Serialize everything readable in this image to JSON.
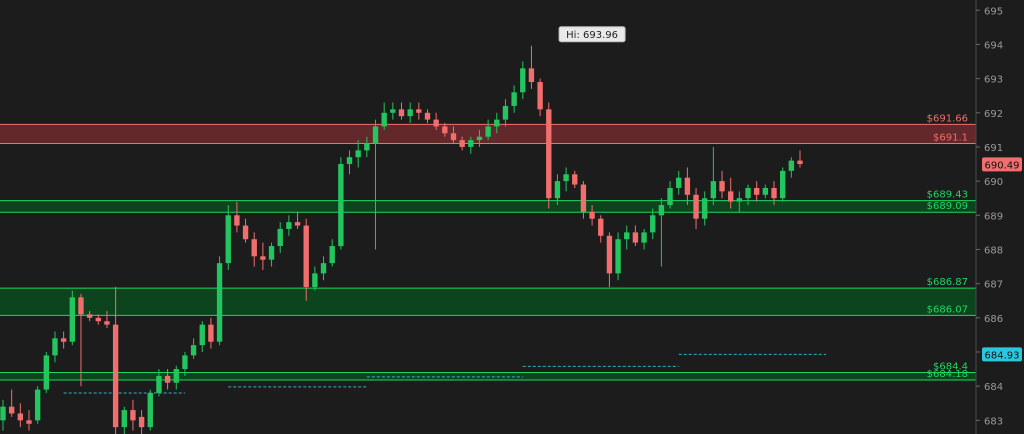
{
  "chart_data": {
    "type": "candlestick",
    "y_axis": {
      "ticks": [
        683,
        684,
        685,
        686,
        687,
        688,
        689,
        690,
        691,
        692,
        693,
        694,
        695
      ],
      "ylim": [
        682.6,
        695.3
      ],
      "position": "right"
    },
    "grid": false,
    "colors": {
      "background": "#1c1c1c",
      "up": "#22c55e",
      "down": "#f26d6d",
      "axis_text": "#9a9a9a",
      "support_zone": "#0b4a1e",
      "support_line": "#1ed760",
      "resistance_zone": "#6e2a2e",
      "resistance_line": "#f26d6d",
      "dashed": "#2bb0c8"
    },
    "high_marker": {
      "label": "Hi: 693.96",
      "price": 693.96,
      "x_index": 68
    },
    "zones": [
      {
        "kind": "resistance",
        "top": 691.66,
        "bottom": 691.1,
        "top_label": "$691.66",
        "bottom_label": "$691.1"
      },
      {
        "kind": "support",
        "top": 689.43,
        "bottom": 689.09,
        "top_label": "$689.43",
        "bottom_label": "$689.09"
      },
      {
        "kind": "support",
        "top": 686.87,
        "bottom": 686.07,
        "top_label": "$686.87",
        "bottom_label": "$686.07"
      },
      {
        "kind": "support",
        "top": 684.4,
        "bottom": 684.18,
        "top_label": "$684.4",
        "bottom_label": "$684.18"
      }
    ],
    "dashed_levels": [
      {
        "price": 683.8,
        "from_index": 7,
        "to_index": 21
      },
      {
        "price": 683.98,
        "from_index": 26,
        "to_index": 42
      },
      {
        "price": 684.27,
        "from_index": 42,
        "to_index": 60
      },
      {
        "price": 684.58,
        "from_index": 60,
        "to_index": 78
      },
      {
        "price": 684.93,
        "from_index": 78,
        "to_index": 95
      }
    ],
    "price_badges": [
      {
        "label": "690.49",
        "price": 690.49,
        "bg": "#f26d6d",
        "fg": "#111111"
      },
      {
        "label": "684.93",
        "price": 684.93,
        "bg": "#2bc6dc",
        "fg": "#111111"
      }
    ],
    "candles": [
      [
        683.0,
        683.6,
        682.7,
        683.4
      ],
      [
        683.4,
        683.9,
        683.1,
        683.2
      ],
      [
        683.2,
        683.5,
        682.8,
        683.0
      ],
      [
        683.0,
        683.3,
        682.7,
        682.9
      ],
      [
        683.0,
        684.0,
        682.9,
        683.9
      ],
      [
        683.9,
        685.0,
        683.8,
        684.9
      ],
      [
        684.9,
        685.6,
        684.7,
        685.4
      ],
      [
        685.4,
        685.6,
        685.1,
        685.3
      ],
      [
        685.3,
        686.8,
        685.2,
        686.6
      ],
      [
        686.6,
        686.7,
        684.0,
        686.1
      ],
      [
        686.1,
        686.2,
        685.9,
        686.0
      ],
      [
        686.0,
        686.1,
        685.8,
        685.9
      ],
      [
        685.9,
        686.2,
        685.7,
        685.8
      ],
      [
        685.8,
        686.9,
        682.6,
        682.8
      ],
      [
        682.8,
        683.4,
        682.6,
        683.3
      ],
      [
        683.3,
        683.6,
        682.7,
        683.0
      ],
      [
        683.1,
        683.3,
        682.6,
        682.8
      ],
      [
        682.8,
        683.9,
        682.7,
        683.8
      ],
      [
        683.8,
        684.5,
        683.7,
        684.3
      ],
      [
        684.3,
        684.5,
        683.9,
        684.1
      ],
      [
        684.1,
        684.6,
        683.9,
        684.5
      ],
      [
        684.5,
        685.0,
        684.3,
        684.9
      ],
      [
        684.9,
        685.4,
        684.8,
        685.2
      ],
      [
        685.2,
        685.9,
        685.0,
        685.8
      ],
      [
        685.8,
        686.0,
        685.1,
        685.3
      ],
      [
        685.3,
        687.8,
        685.2,
        687.6
      ],
      [
        687.6,
        689.3,
        687.4,
        689.0
      ],
      [
        689.0,
        689.4,
        688.5,
        688.7
      ],
      [
        688.7,
        688.9,
        688.2,
        688.3
      ],
      [
        688.3,
        688.5,
        687.5,
        687.8
      ],
      [
        687.8,
        688.2,
        687.4,
        687.7
      ],
      [
        687.7,
        688.2,
        687.5,
        688.1
      ],
      [
        688.1,
        688.8,
        687.9,
        688.6
      ],
      [
        688.6,
        689.0,
        688.4,
        688.8
      ],
      [
        688.8,
        689.1,
        688.6,
        688.7
      ],
      [
        688.7,
        688.9,
        686.5,
        686.9
      ],
      [
        686.9,
        687.5,
        686.8,
        687.3
      ],
      [
        687.3,
        687.8,
        687.1,
        687.6
      ],
      [
        687.6,
        688.3,
        687.5,
        688.1
      ],
      [
        688.1,
        690.7,
        688.0,
        690.5
      ],
      [
        690.5,
        690.9,
        690.2,
        690.7
      ],
      [
        690.7,
        691.2,
        690.4,
        690.9
      ],
      [
        690.9,
        691.3,
        690.7,
        691.1
      ],
      [
        691.1,
        691.8,
        688.0,
        691.6
      ],
      [
        691.6,
        692.3,
        691.5,
        692.0
      ],
      [
        692.0,
        692.3,
        691.8,
        692.1
      ],
      [
        692.1,
        692.3,
        691.8,
        691.9
      ],
      [
        691.9,
        692.3,
        691.7,
        692.1
      ],
      [
        692.1,
        692.3,
        691.8,
        692.0
      ],
      [
        692.0,
        692.1,
        691.7,
        691.8
      ],
      [
        691.8,
        692.0,
        691.5,
        691.6
      ],
      [
        691.6,
        691.7,
        691.3,
        691.4
      ],
      [
        691.4,
        691.6,
        691.1,
        691.2
      ],
      [
        691.2,
        691.3,
        690.9,
        691.0
      ],
      [
        691.0,
        691.3,
        690.8,
        691.2
      ],
      [
        691.2,
        691.5,
        691.0,
        691.3
      ],
      [
        691.3,
        691.8,
        691.2,
        691.6
      ],
      [
        691.6,
        692.0,
        691.4,
        691.8
      ],
      [
        691.8,
        692.4,
        691.6,
        692.2
      ],
      [
        692.2,
        692.8,
        692.0,
        692.6
      ],
      [
        692.6,
        693.5,
        692.4,
        693.3
      ],
      [
        693.3,
        693.96,
        692.7,
        692.9
      ],
      [
        692.9,
        693.0,
        691.9,
        692.1
      ],
      [
        692.1,
        692.3,
        689.2,
        689.5
      ],
      [
        689.5,
        690.2,
        689.3,
        690.0
      ],
      [
        690.0,
        690.4,
        689.7,
        690.2
      ],
      [
        690.2,
        690.3,
        689.8,
        689.9
      ],
      [
        689.9,
        690.0,
        688.9,
        689.1
      ],
      [
        689.1,
        689.3,
        688.7,
        688.9
      ],
      [
        688.9,
        689.0,
        688.2,
        688.4
      ],
      [
        688.4,
        688.5,
        686.9,
        687.3
      ],
      [
        687.3,
        688.5,
        687.1,
        688.3
      ],
      [
        688.3,
        688.7,
        688.0,
        688.5
      ],
      [
        688.5,
        688.7,
        688.1,
        688.2
      ],
      [
        688.2,
        688.6,
        688.0,
        688.5
      ],
      [
        688.5,
        689.2,
        688.3,
        689.0
      ],
      [
        689.0,
        689.5,
        687.5,
        689.3
      ],
      [
        689.3,
        690.0,
        689.2,
        689.8
      ],
      [
        689.8,
        690.3,
        689.6,
        690.1
      ],
      [
        690.1,
        690.4,
        689.3,
        689.6
      ],
      [
        689.6,
        689.8,
        688.6,
        688.9
      ],
      [
        688.9,
        689.7,
        688.7,
        689.5
      ],
      [
        689.5,
        691.0,
        689.3,
        690.0
      ],
      [
        690.0,
        690.3,
        689.5,
        689.7
      ],
      [
        689.7,
        690.1,
        689.2,
        689.4
      ],
      [
        689.4,
        689.7,
        689.1,
        689.5
      ],
      [
        689.5,
        689.9,
        689.3,
        689.8
      ],
      [
        689.8,
        690.0,
        689.4,
        689.6
      ],
      [
        689.6,
        689.9,
        689.5,
        689.8
      ],
      [
        689.8,
        690.0,
        689.3,
        689.5
      ],
      [
        689.5,
        690.4,
        689.4,
        690.3
      ],
      [
        690.3,
        690.7,
        690.1,
        690.6
      ],
      [
        690.6,
        690.9,
        690.4,
        690.5
      ]
    ]
  }
}
